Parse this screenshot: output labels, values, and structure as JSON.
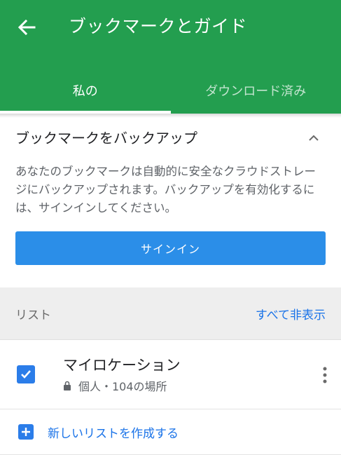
{
  "appbar": {
    "title": "ブックマークとガイド",
    "tabs": [
      {
        "label": "私の",
        "active": true
      },
      {
        "label": "ダウンロード済み",
        "active": false
      }
    ],
    "color": "#239e4f"
  },
  "backup": {
    "heading": "ブックマークをバックアップ",
    "description": "あなたのブックマークは自動的に安全なクラウドストレージにバックアップされます。バックアップを有効化するには、サインインしてください。",
    "signin_label": "サインイン",
    "button_color": "#2b8ee8"
  },
  "lists": {
    "header_label": "リスト",
    "hide_all_label": "すべて非表示",
    "items": [
      {
        "name": "マイロケーション",
        "meta": "個人・104の場所",
        "checked": true
      }
    ],
    "create_label": "新しいリストを作成する"
  }
}
